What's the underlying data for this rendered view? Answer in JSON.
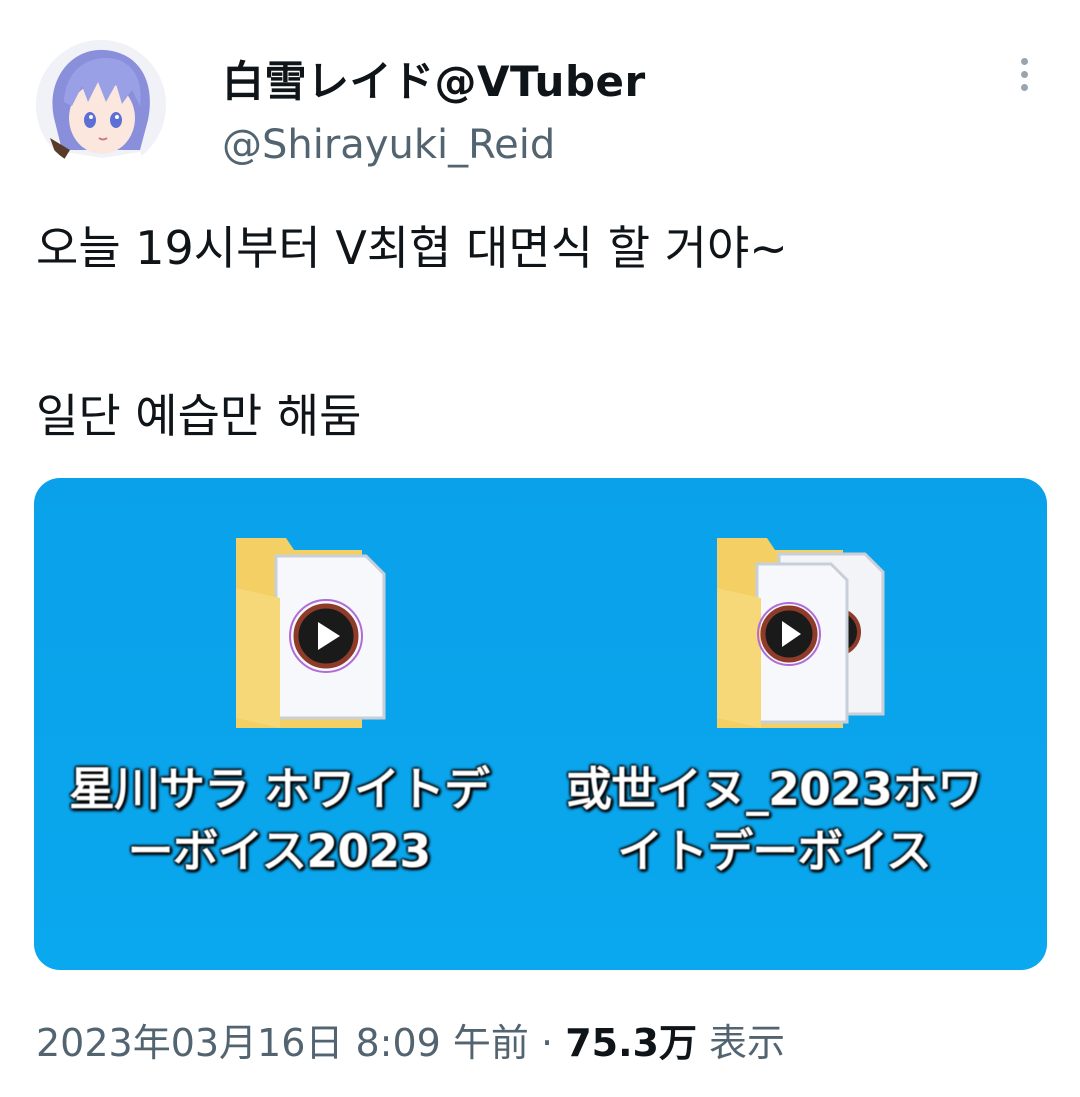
{
  "author": {
    "display_name": "白雪レイド@VTuber",
    "handle": "@Shirayuki_Reid",
    "avatar_icon": "avatar-image"
  },
  "tweet": {
    "line1": "오늘 19시부터 V최협 대면식 할 거야~",
    "line2": "일단 예습만 해둠"
  },
  "media": {
    "icons": [
      {
        "line1": "星川サラ ホワイトデ",
        "line2": "ーボイス2023",
        "icon": "folder-icon"
      },
      {
        "line1": "或世イヌ_2023ホワ",
        "line2": "イトデーボイス",
        "icon": "folder-icon"
      }
    ],
    "background": "#0aa5ec"
  },
  "footer": {
    "timestamp": "2023年03月16日 8:09 午前",
    "separator": "·",
    "views_count": "75.3万",
    "views_label": "表示"
  },
  "colors": {
    "text": "#0f1419",
    "secondary": "#536471"
  }
}
